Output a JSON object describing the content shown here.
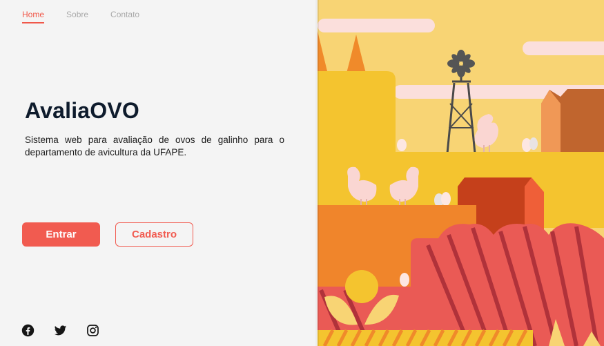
{
  "nav": {
    "items": [
      {
        "label": "Home",
        "active": true
      },
      {
        "label": "Sobre",
        "active": false
      },
      {
        "label": "Contato",
        "active": false
      }
    ]
  },
  "hero": {
    "title": "AvaliaOVO",
    "description": "Sistema web para avaliação de ovos de galinho para o departamento de avicultura da UFAPE."
  },
  "actions": {
    "login_label": "Entrar",
    "signup_label": "Cadastro"
  },
  "socials": [
    "facebook-icon",
    "twitter-icon",
    "instagram-icon"
  ],
  "colors": {
    "accent": "#f15b50",
    "title": "#0e1b2c",
    "background": "#f4f4f4",
    "nav_inactive": "#a9a9a9"
  }
}
